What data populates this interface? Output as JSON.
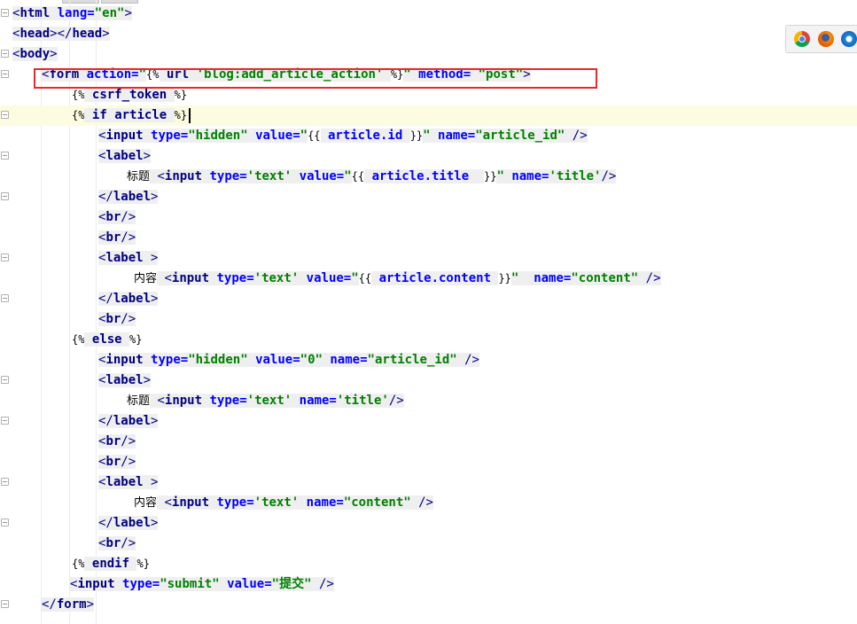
{
  "editor": {
    "lines": [
      {
        "segs": [
          [
            "lt",
            "<"
          ],
          [
            "tag",
            "html"
          ],
          [
            "plain",
            " "
          ],
          [
            "attr",
            "lang="
          ],
          [
            "str",
            "\"en\""
          ],
          [
            "lt",
            ">"
          ]
        ]
      },
      {
        "segs": [
          [
            "lt",
            "<"
          ],
          [
            "tag",
            "head"
          ],
          [
            "lt",
            "></"
          ],
          [
            "tag",
            "head"
          ],
          [
            "lt",
            ">"
          ]
        ]
      },
      {
        "segs": [
          [
            "lt",
            "<"
          ],
          [
            "tag",
            "body"
          ],
          [
            "lt",
            ">"
          ]
        ]
      },
      {
        "segs": [
          [
            "lt",
            "<"
          ],
          [
            "tag",
            "form"
          ],
          [
            "plain",
            " "
          ],
          [
            "attr",
            "action="
          ],
          [
            "str",
            "\""
          ],
          [
            "tpl",
            "{%"
          ],
          [
            "plain",
            " "
          ],
          [
            "tplkw",
            "url"
          ],
          [
            "plain",
            " "
          ],
          [
            "str",
            "'blog:add_article_action'"
          ],
          [
            "plain",
            " "
          ],
          [
            "tpl",
            "%}"
          ],
          [
            "str",
            "\""
          ],
          [
            "plain",
            " "
          ],
          [
            "attr",
            "method="
          ],
          [
            "plain",
            " "
          ],
          [
            "str",
            "\"post\""
          ],
          [
            "lt",
            ">"
          ]
        ]
      },
      {
        "segs": [
          [
            "tpl",
            "{%"
          ],
          [
            "plain",
            " "
          ],
          [
            "tplkw",
            "csrf_token"
          ],
          [
            "plain",
            " "
          ],
          [
            "tpl",
            "%}"
          ]
        ]
      },
      {
        "segs": [
          [
            "tpl",
            "{%"
          ],
          [
            "plain",
            " "
          ],
          [
            "tplkw",
            "if"
          ],
          [
            "plain",
            " "
          ],
          [
            "tplkw",
            "article"
          ],
          [
            "plain",
            " "
          ],
          [
            "tpl",
            "%}"
          ]
        ]
      },
      {
        "segs": [
          [
            "lt",
            "<"
          ],
          [
            "tag",
            "input"
          ],
          [
            "plain",
            " "
          ],
          [
            "attr",
            "type="
          ],
          [
            "str",
            "\"hidden\""
          ],
          [
            "plain",
            " "
          ],
          [
            "attr",
            "value="
          ],
          [
            "str",
            "\""
          ],
          [
            "tpl",
            "{{"
          ],
          [
            "plain",
            " "
          ],
          [
            "attr",
            "article.id"
          ],
          [
            "plain",
            " "
          ],
          [
            "tpl",
            "}}"
          ],
          [
            "str",
            "\""
          ],
          [
            "plain",
            " "
          ],
          [
            "attr",
            "name="
          ],
          [
            "str",
            "\"article_id\""
          ],
          [
            "plain",
            " "
          ],
          [
            "lt",
            "/>"
          ]
        ]
      },
      {
        "segs": [
          [
            "lt",
            "<"
          ],
          [
            "tag",
            "label"
          ],
          [
            "lt",
            ">"
          ]
        ]
      },
      {
        "segs": [
          [
            "cjk",
            "标题"
          ],
          [
            "plain",
            " "
          ],
          [
            "lt",
            "<"
          ],
          [
            "tag",
            "input"
          ],
          [
            "plain",
            " "
          ],
          [
            "attr",
            "type="
          ],
          [
            "str",
            "'text'"
          ],
          [
            "plain",
            " "
          ],
          [
            "attr",
            "value="
          ],
          [
            "str",
            "\""
          ],
          [
            "tpl",
            "{{"
          ],
          [
            "plain",
            " "
          ],
          [
            "attr",
            "article.title"
          ],
          [
            "plain",
            "  "
          ],
          [
            "tpl",
            "}}"
          ],
          [
            "str",
            "\""
          ],
          [
            "plain",
            " "
          ],
          [
            "attr",
            "name="
          ],
          [
            "str",
            "'title'"
          ],
          [
            "lt",
            "/>"
          ]
        ]
      },
      {
        "segs": [
          [
            "lt",
            "</"
          ],
          [
            "tag",
            "label"
          ],
          [
            "lt",
            ">"
          ]
        ]
      },
      {
        "segs": [
          [
            "lt",
            "<"
          ],
          [
            "tag",
            "br"
          ],
          [
            "lt",
            "/>"
          ]
        ]
      },
      {
        "segs": [
          [
            "lt",
            "<"
          ],
          [
            "tag",
            "br"
          ],
          [
            "lt",
            "/>"
          ]
        ]
      },
      {
        "segs": [
          [
            "lt",
            "<"
          ],
          [
            "tag",
            "label"
          ],
          [
            "plain",
            " "
          ],
          [
            "lt",
            ">"
          ]
        ]
      },
      {
        "segs": [
          [
            "cjk",
            "内容"
          ],
          [
            "plain",
            " "
          ],
          [
            "lt",
            "<"
          ],
          [
            "tag",
            "input"
          ],
          [
            "plain",
            " "
          ],
          [
            "attr",
            "type="
          ],
          [
            "str",
            "'text'"
          ],
          [
            "plain",
            " "
          ],
          [
            "attr",
            "value="
          ],
          [
            "str",
            "\""
          ],
          [
            "tpl",
            "{{"
          ],
          [
            "plain",
            " "
          ],
          [
            "attr",
            "article.content"
          ],
          [
            "plain",
            " "
          ],
          [
            "tpl",
            "}}"
          ],
          [
            "str",
            "\""
          ],
          [
            "plain",
            "  "
          ],
          [
            "attr",
            "name="
          ],
          [
            "str",
            "\"content\""
          ],
          [
            "plain",
            " "
          ],
          [
            "lt",
            "/>"
          ]
        ]
      },
      {
        "segs": [
          [
            "lt",
            "</"
          ],
          [
            "tag",
            "label"
          ],
          [
            "lt",
            ">"
          ]
        ]
      },
      {
        "segs": [
          [
            "lt",
            "<"
          ],
          [
            "tag",
            "br"
          ],
          [
            "lt",
            "/>"
          ]
        ]
      },
      {
        "segs": [
          [
            "tpl",
            "{%"
          ],
          [
            "plain",
            " "
          ],
          [
            "tplkw",
            "else"
          ],
          [
            "plain",
            " "
          ],
          [
            "tpl",
            "%}"
          ]
        ]
      },
      {
        "segs": [
          [
            "lt",
            "<"
          ],
          [
            "tag",
            "input"
          ],
          [
            "plain",
            " "
          ],
          [
            "attr",
            "type="
          ],
          [
            "str",
            "\"hidden\""
          ],
          [
            "plain",
            " "
          ],
          [
            "attr",
            "value="
          ],
          [
            "str",
            "\"0\""
          ],
          [
            "plain",
            " "
          ],
          [
            "attr",
            "name="
          ],
          [
            "str",
            "\"article_id\""
          ],
          [
            "plain",
            " "
          ],
          [
            "lt",
            "/>"
          ]
        ]
      },
      {
        "segs": [
          [
            "lt",
            "<"
          ],
          [
            "tag",
            "label"
          ],
          [
            "lt",
            ">"
          ]
        ]
      },
      {
        "segs": [
          [
            "cjk",
            "标题"
          ],
          [
            "plain",
            " "
          ],
          [
            "lt",
            "<"
          ],
          [
            "tag",
            "input"
          ],
          [
            "plain",
            " "
          ],
          [
            "attr",
            "type="
          ],
          [
            "str",
            "'text'"
          ],
          [
            "plain",
            " "
          ],
          [
            "attr",
            "name="
          ],
          [
            "str",
            "'title'"
          ],
          [
            "lt",
            "/>"
          ]
        ]
      },
      {
        "segs": [
          [
            "lt",
            "</"
          ],
          [
            "tag",
            "label"
          ],
          [
            "lt",
            ">"
          ]
        ]
      },
      {
        "segs": [
          [
            "lt",
            "<"
          ],
          [
            "tag",
            "br"
          ],
          [
            "lt",
            "/>"
          ]
        ]
      },
      {
        "segs": [
          [
            "lt",
            "<"
          ],
          [
            "tag",
            "br"
          ],
          [
            "lt",
            "/>"
          ]
        ]
      },
      {
        "segs": [
          [
            "lt",
            "<"
          ],
          [
            "tag",
            "label"
          ],
          [
            "plain",
            " "
          ],
          [
            "lt",
            ">"
          ]
        ]
      },
      {
        "segs": [
          [
            "cjk",
            "内容"
          ],
          [
            "plain",
            " "
          ],
          [
            "lt",
            "<"
          ],
          [
            "tag",
            "input"
          ],
          [
            "plain",
            " "
          ],
          [
            "attr",
            "type="
          ],
          [
            "str",
            "'text'"
          ],
          [
            "plain",
            " "
          ],
          [
            "attr",
            "name="
          ],
          [
            "str",
            "\"content\""
          ],
          [
            "plain",
            " "
          ],
          [
            "lt",
            "/>"
          ]
        ]
      },
      {
        "segs": [
          [
            "lt",
            "</"
          ],
          [
            "tag",
            "label"
          ],
          [
            "lt",
            ">"
          ]
        ]
      },
      {
        "segs": [
          [
            "lt",
            "<"
          ],
          [
            "tag",
            "br"
          ],
          [
            "lt",
            "/>"
          ]
        ]
      },
      {
        "segs": [
          [
            "tpl",
            "{%"
          ],
          [
            "plain",
            " "
          ],
          [
            "tplkw",
            "endif"
          ],
          [
            "plain",
            " "
          ],
          [
            "tpl",
            "%}"
          ]
        ]
      },
      {
        "segs": [
          [
            "lt",
            "<"
          ],
          [
            "tag",
            "input"
          ],
          [
            "plain",
            " "
          ],
          [
            "attr",
            "type="
          ],
          [
            "str",
            "\"submit\""
          ],
          [
            "plain",
            " "
          ],
          [
            "attr",
            "value="
          ],
          [
            "str",
            "\"提交\""
          ],
          [
            "plain",
            " "
          ],
          [
            "lt",
            "/>"
          ]
        ]
      },
      {
        "segs": [
          [
            "lt",
            "</"
          ],
          [
            "tag",
            "form"
          ],
          [
            "lt",
            ">"
          ]
        ]
      }
    ],
    "current_line": 5,
    "highlighted_line": 3
  },
  "browser_preview": {
    "icons": [
      "chrome-icon",
      "firefox-icon",
      "safari-icon"
    ]
  },
  "colors": {
    "highlight_box": "#e8292b",
    "current_line_bg": "#fefce0",
    "tag": "#000080",
    "attribute": "#0000ff",
    "string": "#008000"
  }
}
